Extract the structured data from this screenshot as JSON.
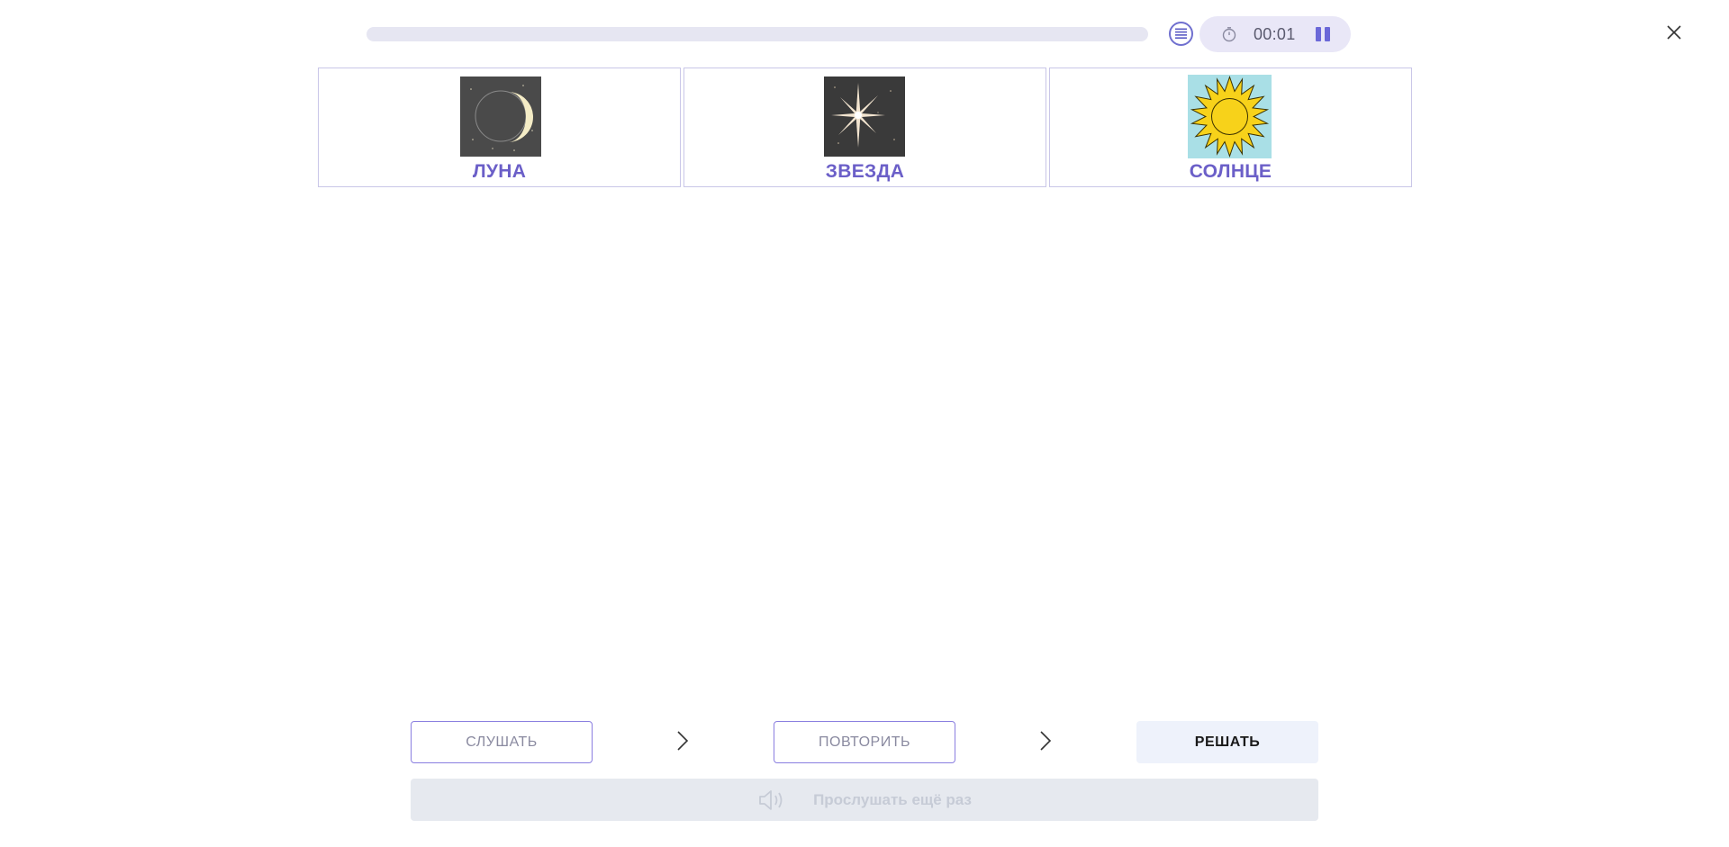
{
  "progress": {
    "value": 0
  },
  "timer": {
    "text": "00:01"
  },
  "icons": {
    "list": "list-icon",
    "timer": "stopwatch-icon",
    "pause": "pause-icon",
    "close": "close-icon",
    "chevron": "chevron-right-icon",
    "speaker": "speaker-icon"
  },
  "cards": [
    {
      "label": "ЛУНА",
      "image": "moon-image"
    },
    {
      "label": "ЗВЕЗДА",
      "image": "star-image"
    },
    {
      "label": "СОЛНЦЕ",
      "image": "sun-image"
    }
  ],
  "steps": {
    "listen": "СЛУШАТЬ",
    "repeat": "ПОВТОРИТЬ",
    "solve": "РЕШАТЬ"
  },
  "replay": {
    "label": "Прослушать ещё раз"
  },
  "colors": {
    "accent": "#6b5fc8",
    "pill": "#e9e7f7",
    "card_border": "#c9c6e8",
    "disabled_bg": "#e6e9ef"
  }
}
